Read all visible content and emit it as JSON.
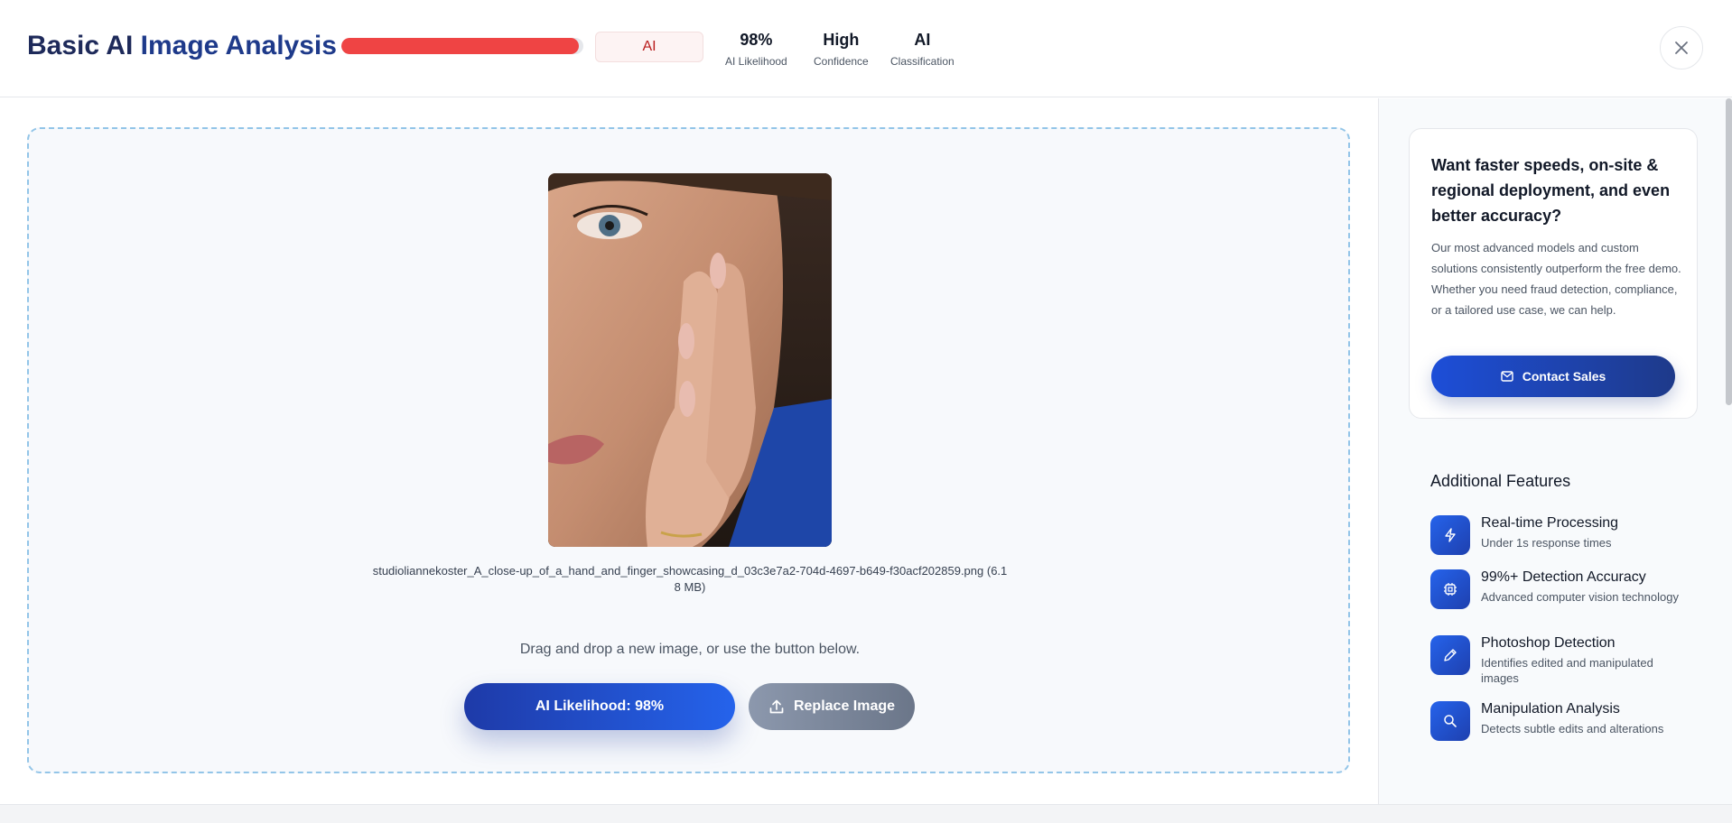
{
  "header": {
    "title_part1": "Basic AI",
    "title_part2": "Image Analysis",
    "ai_likelihood_fraction": 0.98,
    "classification_pill": "AI",
    "stats": [
      {
        "value": "98%",
        "label": "AI Likelihood"
      },
      {
        "value": "High",
        "label": "Confidence"
      },
      {
        "value": "AI",
        "label": "Classification"
      }
    ],
    "close_icon": "close-icon"
  },
  "main": {
    "filename": "studioliannekoster_A_close-up_of_a_hand_and_finger_showcasing_d_03c3e7a2-704d-4697-b649-f30acf202859.png (6.18 MB)",
    "hint": "Drag and drop a new image, or use the button below.",
    "primary_button": "AI Likelihood: 98%",
    "secondary_button": "Replace Image",
    "secondary_icon": "upload-icon"
  },
  "sidebar": {
    "promo_title": "Want faster speeds, on-site & regional deployment, and even better accuracy?",
    "promo_body": "Our most advanced models and custom solutions consistently outperform the free demo. Whether you need fraud detection, compliance, or a tailored use case, we can help.",
    "contact_button": "Contact Sales",
    "contact_icon": "mail-icon",
    "features_title": "Additional Features",
    "features": [
      {
        "name": "Real-time Processing",
        "desc": "Under 1s response times",
        "icon": "lightning-icon"
      },
      {
        "name": "99%+ Detection Accuracy",
        "desc": "Advanced computer vision technology",
        "icon": "chip-icon"
      },
      {
        "name": "Photoshop Detection",
        "desc": "Identifies edited and manipulated images",
        "icon": "pencil-icon"
      },
      {
        "name": "Manipulation Analysis",
        "desc": "Detects subtle edits and alterations",
        "icon": "search-icon"
      }
    ]
  },
  "colors": {
    "progress_fill": "#ef4444",
    "accent_blue": "#1e3a8a",
    "primary_button": "#2563eb"
  }
}
